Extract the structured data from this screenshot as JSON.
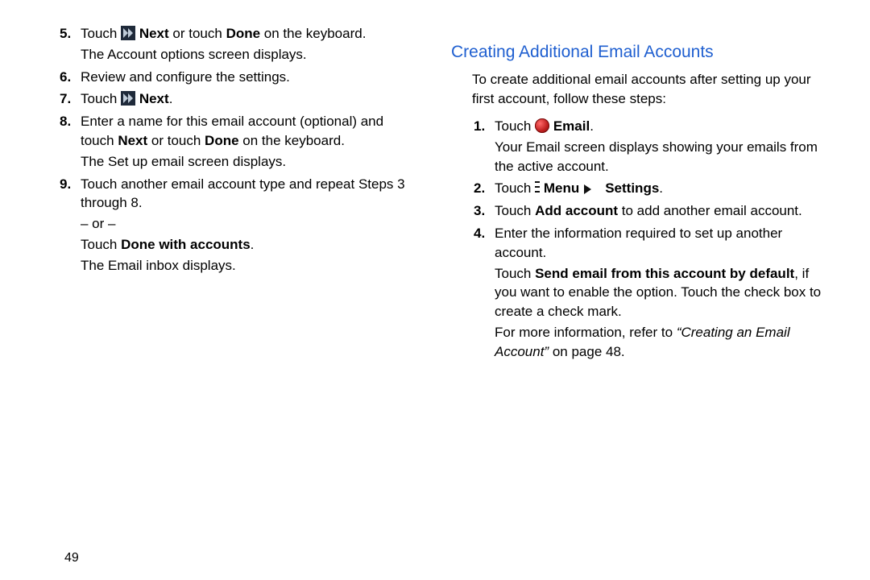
{
  "page_number": "49",
  "left": {
    "steps": [
      {
        "num": "5.",
        "parts": [
          {
            "t": "text",
            "v": "Touch "
          },
          {
            "t": "icon",
            "v": "next"
          },
          {
            "t": "text",
            "v": " "
          },
          {
            "t": "bold",
            "v": "Next"
          },
          {
            "t": "text",
            "v": " or touch "
          },
          {
            "t": "bold",
            "v": "Done"
          },
          {
            "t": "text",
            "v": " on the keyboard."
          }
        ],
        "after": [
          "The Account options screen displays."
        ]
      },
      {
        "num": "6.",
        "parts": [
          {
            "t": "text",
            "v": "Review and configure the settings."
          }
        ]
      },
      {
        "num": "7.",
        "parts": [
          {
            "t": "text",
            "v": "Touch "
          },
          {
            "t": "icon",
            "v": "next"
          },
          {
            "t": "text",
            "v": " "
          },
          {
            "t": "bold",
            "v": "Next"
          },
          {
            "t": "text",
            "v": "."
          }
        ]
      },
      {
        "num": "8.",
        "parts": [
          {
            "t": "text",
            "v": "Enter a name for this email account (optional) and touch "
          },
          {
            "t": "bold",
            "v": "Next"
          },
          {
            "t": "text",
            "v": " or touch "
          },
          {
            "t": "bold",
            "v": "Done"
          },
          {
            "t": "text",
            "v": " on the keyboard."
          }
        ],
        "after": [
          "The Set up email screen displays."
        ]
      },
      {
        "num": "9.",
        "parts": [
          {
            "t": "text",
            "v": "Touch another email account type and repeat Steps 3 through 8."
          }
        ],
        "after_rich": [
          [
            {
              "t": "text",
              "v": "– or –"
            }
          ],
          [
            {
              "t": "text",
              "v": "Touch "
            },
            {
              "t": "bold",
              "v": "Done with accounts"
            },
            {
              "t": "text",
              "v": "."
            }
          ],
          [
            {
              "t": "text",
              "v": "The Email inbox displays."
            }
          ]
        ]
      }
    ]
  },
  "right": {
    "title": "Creating Additional Email Accounts",
    "intro": "To create additional email accounts after setting up your first account, follow these steps:",
    "steps": [
      {
        "num": "1.",
        "parts": [
          {
            "t": "text",
            "v": "Touch "
          },
          {
            "t": "icon",
            "v": "email"
          },
          {
            "t": "text",
            "v": " "
          },
          {
            "t": "bold",
            "v": "Email"
          },
          {
            "t": "text",
            "v": "."
          }
        ],
        "after": [
          "Your Email screen displays showing your emails from the active account."
        ]
      },
      {
        "num": "2.",
        "parts": [
          {
            "t": "text",
            "v": "Touch "
          },
          {
            "t": "icon",
            "v": "menu"
          },
          {
            "t": "text",
            "v": " "
          },
          {
            "t": "bold",
            "v": "Menu"
          },
          {
            "t": "icon",
            "v": "arrow"
          },
          {
            "t": "bold",
            "v": "Settings"
          },
          {
            "t": "text",
            "v": "."
          }
        ]
      },
      {
        "num": "3.",
        "parts": [
          {
            "t": "text",
            "v": "Touch "
          },
          {
            "t": "bold",
            "v": "Add account"
          },
          {
            "t": "text",
            "v": " to add another email account."
          }
        ]
      },
      {
        "num": "4.",
        "parts": [
          {
            "t": "text",
            "v": "Enter the information required to set up another account."
          }
        ],
        "after_rich": [
          [
            {
              "t": "text",
              "v": "Touch "
            },
            {
              "t": "bold",
              "v": "Send email from this account by default"
            },
            {
              "t": "text",
              "v": ", if you want to enable the option. Touch the check box to create a check mark."
            }
          ],
          [
            {
              "t": "text",
              "v": "For more information, refer to "
            },
            {
              "t": "ital",
              "v": "“Creating an Email Account”"
            },
            {
              "t": "text",
              "v": " on page 48."
            }
          ]
        ]
      }
    ]
  }
}
